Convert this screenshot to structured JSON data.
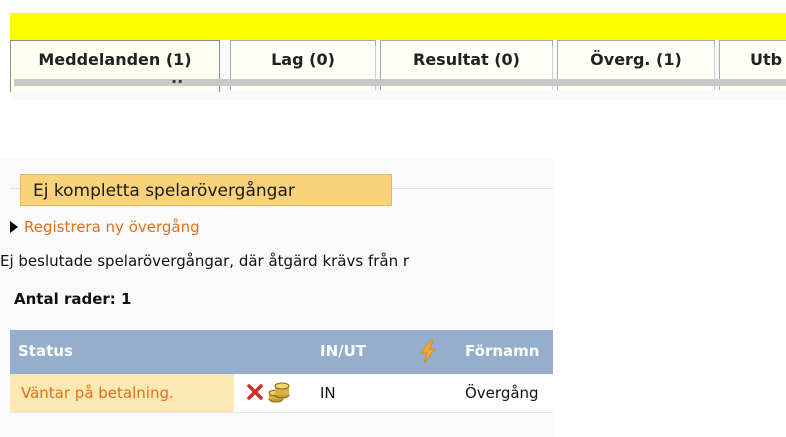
{
  "tabs": [
    {
      "label": "Meddelanden (1)",
      "active": true
    },
    {
      "label": "Lag (0)",
      "active": false
    },
    {
      "label": "Resultat (0)",
      "active": false
    },
    {
      "label": "Överg. (1)",
      "active": false
    },
    {
      "label": "Utb",
      "active": false
    }
  ],
  "tab_fragment": "..",
  "section": {
    "title": "Ej kompletta spelarövergångar",
    "register_link": "Registrera ny övergång",
    "description": "Ej beslutade spelarövergångar, där åtgärd krävs från r",
    "row_count": "Antal rader: 1"
  },
  "table": {
    "headers": {
      "status": "Status",
      "in_out": "IN/UT",
      "lightning_icon": "lightning-icon",
      "firstname": "Förnamn"
    },
    "rows": [
      {
        "status": "Väntar på betalning.",
        "delete_icon": "close-icon",
        "payment_icon": "coins-icon",
        "in_out": "IN",
        "firstname": "Övergång"
      }
    ]
  },
  "colors": {
    "top_band": "#ffff00",
    "section_title_bg": "#f9d27a",
    "link": "#e06f1c",
    "table_header": "#94aecb",
    "status_cell_bg": "#fce8b3",
    "delete_icon": "#d22b2b"
  }
}
